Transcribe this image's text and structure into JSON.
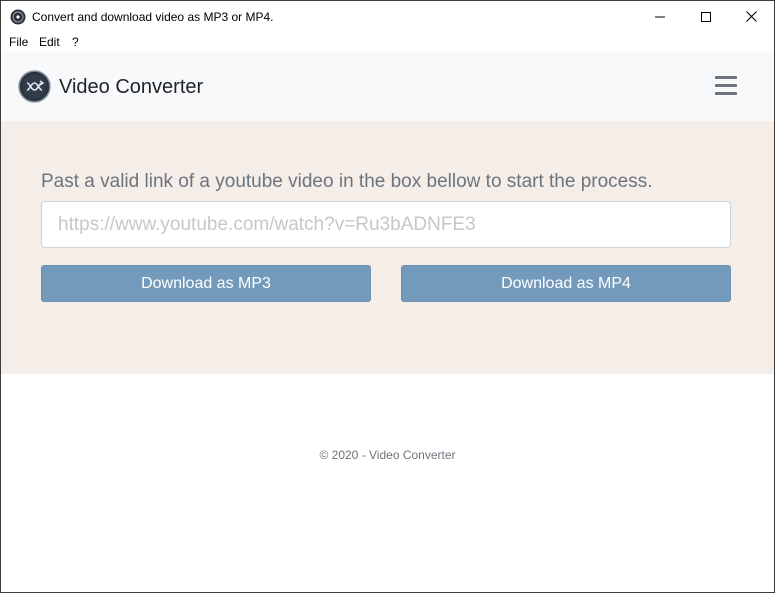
{
  "window": {
    "title": "Convert and download video as MP3 or MP4.",
    "icon": "app-disc-icon"
  },
  "menu": {
    "items": [
      "File",
      "Edit",
      "?"
    ]
  },
  "navbar": {
    "brand": "Video Converter",
    "logo_icon": "brand-logo-icon",
    "toggle_icon": "hamburger-menu-icon"
  },
  "hero": {
    "instruction": "Past a valid link of a youtube video in the box bellow to start the process.",
    "url_placeholder": "https://www.youtube.com/watch?v=Ru3bADNFE3",
    "url_value": "",
    "mp3_label": "Download as MP3",
    "mp4_label": "Download as MP4"
  },
  "footer": {
    "text": "© 2020 - Video Converter"
  },
  "colors": {
    "hero_bg": "#f5ede8",
    "navbar_bg": "#f8f9fa",
    "button_bg": "#7399bb",
    "text_muted": "#6c757d"
  }
}
